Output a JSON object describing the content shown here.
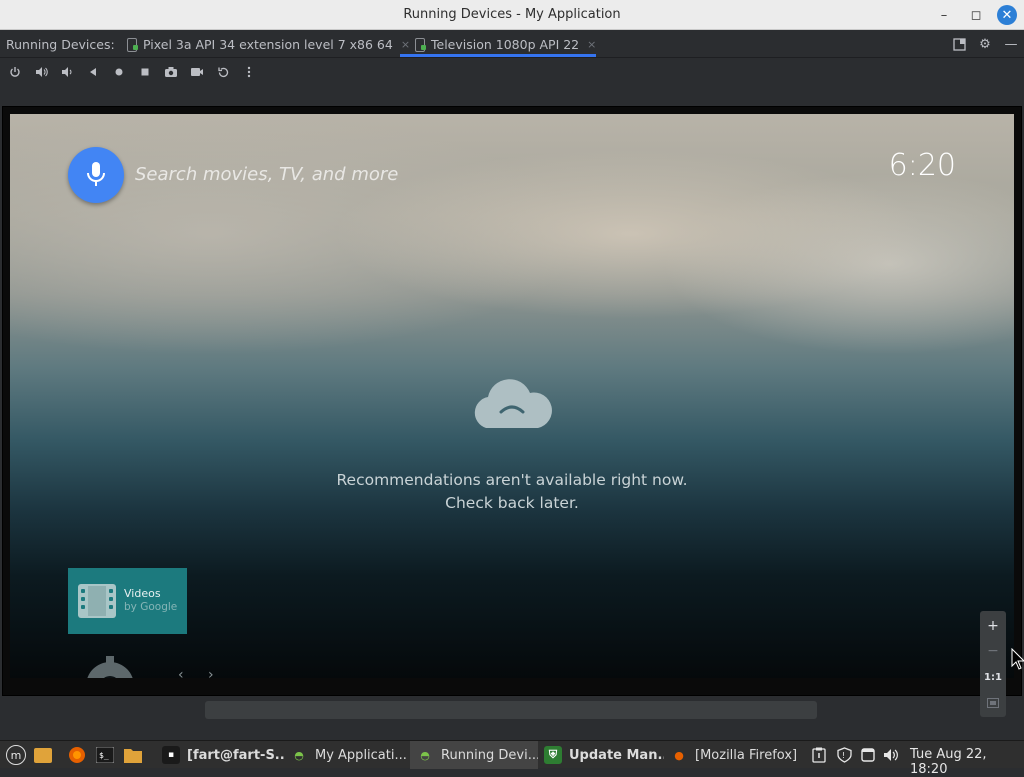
{
  "window": {
    "title": "Running Devices - My Application",
    "controls": {
      "minimize": "–",
      "maximize": "◻",
      "close": "✕"
    }
  },
  "tabs": {
    "label": "Running Devices:",
    "items": [
      {
        "label": "Pixel 3a API 34 extension level 7 x86 64",
        "close": "×",
        "active": false
      },
      {
        "label": "Television 1080p API 22",
        "close": "×",
        "active": true
      }
    ],
    "accent": "#3574f0"
  },
  "toolbar": {
    "icons": [
      "power-icon",
      "volume-up-icon",
      "volume-down-icon",
      "back-icon",
      "home-icon",
      "overview-icon",
      "camera-icon",
      "video-icon",
      "rotate-icon",
      "more-icon"
    ]
  },
  "tv": {
    "search_placeholder": "Search movies, TV, and more",
    "clock": "6:20",
    "message_line1": "Recommendations aren't available right now.",
    "message_line2": "Check back later.",
    "app_tile": {
      "title": "Videos",
      "subtitle": "by Google"
    },
    "mic_color": "#4285f4"
  },
  "zoom": {
    "zoom_in": "+",
    "zoom_out": "−",
    "actual_size": "1:1"
  },
  "taskbar": {
    "items": [
      {
        "label": "[fart@fart-S...",
        "icon": "terminal-icon"
      },
      {
        "label": "My Applicati...",
        "icon": "android-icon"
      },
      {
        "label": "Running Devi...",
        "icon": "android-studio-icon"
      },
      {
        "label": "Update Man...",
        "icon": "shield-icon"
      },
      {
        "label": "[Mozilla Firefox]",
        "icon": "firefox-icon"
      }
    ],
    "datetime": "Tue Aug 22, 18:20"
  }
}
